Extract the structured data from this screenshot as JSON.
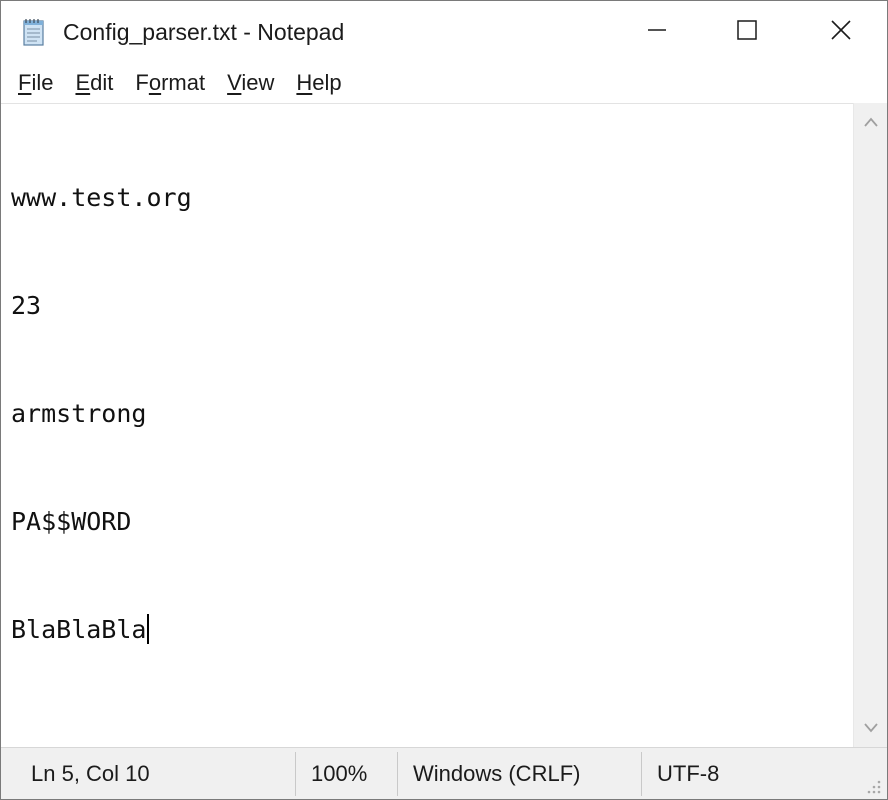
{
  "window": {
    "title": "Config_parser.txt - Notepad",
    "icon": "notepad-icon",
    "controls": {
      "minimize_icon": "minimize-icon",
      "maximize_icon": "maximize-icon",
      "close_icon": "close-icon"
    }
  },
  "menu": {
    "items": [
      {
        "accel": "F",
        "rest": "ile"
      },
      {
        "accel": "E",
        "rest": "dit"
      },
      {
        "pre": "F",
        "accel": "o",
        "rest": "rmat"
      },
      {
        "accel": "V",
        "rest": "iew"
      },
      {
        "accel": "H",
        "rest": "elp"
      }
    ]
  },
  "editor": {
    "lines": [
      "www.test.org",
      "23",
      "armstrong",
      "PA$$WORD",
      "BlaBlaBla"
    ],
    "caret_line": 5,
    "caret_col": 10
  },
  "status": {
    "position": "Ln 5, Col 10",
    "zoom": "100%",
    "line_ending": "Windows (CRLF)",
    "encoding": "UTF-8"
  },
  "colors": {
    "window_bg": "#ffffff",
    "statusbar_bg": "#f0f0f0",
    "scrollbar_bg": "#f0f0f0",
    "text": "#1b1b1b"
  }
}
